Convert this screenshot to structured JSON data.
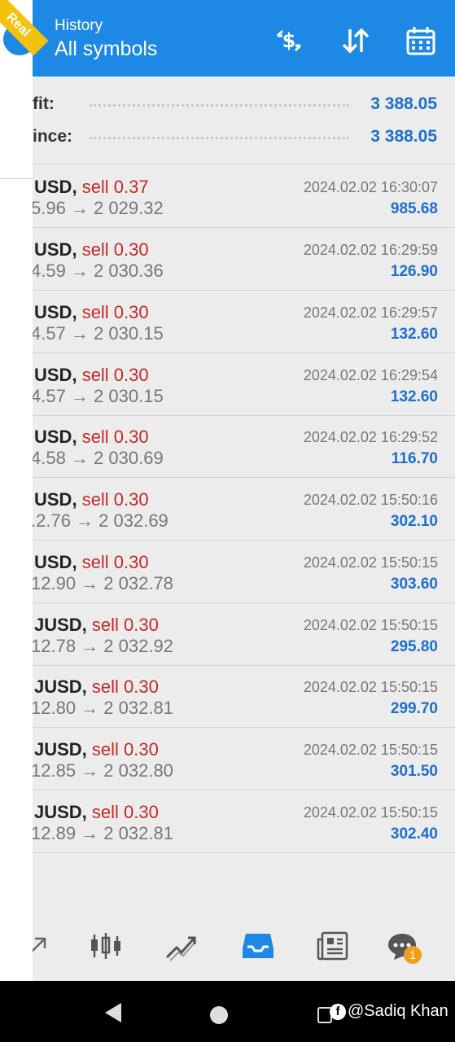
{
  "header": {
    "title": "History",
    "subtitle": "All symbols",
    "icons": [
      "currency-icon",
      "sort-icon",
      "calendar-icon"
    ]
  },
  "account_badge": "Real",
  "summary": {
    "profit_label": "fit:",
    "profit_value": "3 388.05",
    "balance_label": "ince:",
    "balance_value": "3 388.05"
  },
  "deals": [
    {
      "symbol": "USD,",
      "side": "sell 0.37",
      "prices": "5.96 → 2 029.32",
      "time": "2024.02.02 16:30:07",
      "profit": "985.68"
    },
    {
      "symbol": "USD,",
      "side": "sell 0.30",
      "prices": "4.59 → 2 030.36",
      "time": "2024.02.02 16:29:59",
      "profit": "126.90"
    },
    {
      "symbol": "USD,",
      "side": "sell 0.30",
      "prices": "4.57 → 2 030.15",
      "time": "2024.02.02 16:29:57",
      "profit": "132.60"
    },
    {
      "symbol": "USD,",
      "side": "sell 0.30",
      "prices": "4.57 → 2 030.15",
      "time": "2024.02.02 16:29:54",
      "profit": "132.60"
    },
    {
      "symbol": "USD,",
      "side": "sell 0.30",
      "prices": "4.58 → 2 030.69",
      "time": "2024.02.02 16:29:52",
      "profit": "116.70"
    },
    {
      "symbol": "USD,",
      "side": "sell 0.30",
      "prices": ".2.76 → 2 032.69",
      "time": "2024.02.02 15:50:16",
      "profit": "302.10"
    },
    {
      "symbol": "USD,",
      "side": "sell 0.30",
      "prices": "12.90 → 2 032.78",
      "time": "2024.02.02 15:50:15",
      "profit": "303.60"
    },
    {
      "symbol": "JUSD,",
      "side": "sell 0.30",
      "prices": "12.78 → 2 032.92",
      "time": "2024.02.02 15:50:15",
      "profit": "295.80"
    },
    {
      "symbol": "JUSD,",
      "side": "sell 0.30",
      "prices": "12.80 → 2 032.81",
      "time": "2024.02.02 15:50:15",
      "profit": "299.70"
    },
    {
      "symbol": "JUSD,",
      "side": "sell 0.30",
      "prices": "12.85 → 2 032.80",
      "time": "2024.02.02 15:50:15",
      "profit": "301.50"
    },
    {
      "symbol": "JUSD,",
      "side": "sell 0.30",
      "prices": "12.89 → 2 032.81",
      "time": "2024.02.02 15:50:15",
      "profit": "302.40"
    }
  ],
  "bottom_nav": {
    "items": [
      "trade-icon",
      "chart-icon",
      "trend-icon",
      "history-icon",
      "news-icon",
      "chat-icon"
    ],
    "active": "history-icon",
    "chat_badge": "1"
  },
  "watermark": "@Sadiq Khan",
  "colors": {
    "accent": "#1e88e5",
    "sell": "#c62828",
    "profit": "#1e6fd0",
    "badge": "#f4c20d"
  }
}
